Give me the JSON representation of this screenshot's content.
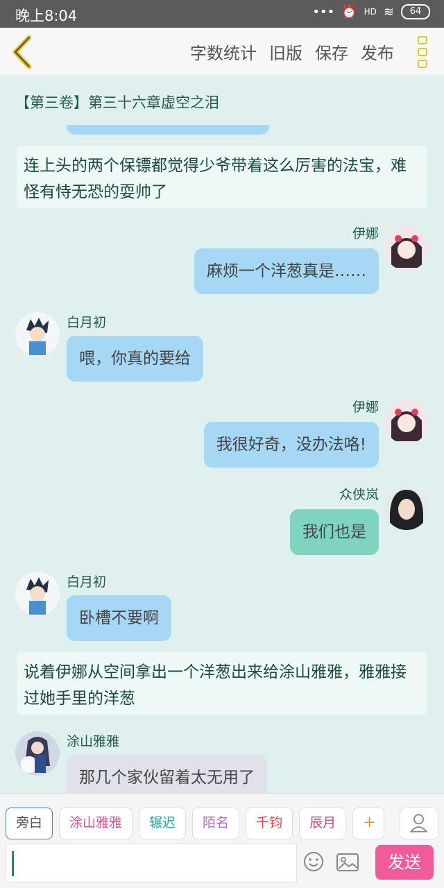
{
  "status": {
    "time": "晚上8:04",
    "signal_label": "HD",
    "battery": "64"
  },
  "topbar": {
    "actions": [
      "字数统计",
      "旧版",
      "保存",
      "发布"
    ]
  },
  "chapter_title": "【第三卷】第三十六章虚空之泪",
  "messages": [
    {
      "type": "narration",
      "text": "连上头的两个保镖都觉得少爷带着这么厉害的法宝，难怪有恃无恐的耍帅了"
    },
    {
      "type": "message",
      "side": "right",
      "name": "伊娜",
      "text": "麻烦一个洋葱真是……",
      "color": "#a6d7f5"
    },
    {
      "type": "message",
      "side": "left",
      "name": "白月初",
      "text": "喂，你真的要给",
      "color": "#a6d7f5"
    },
    {
      "type": "message",
      "side": "right",
      "name": "伊娜",
      "text": "我很好奇，没办法咯!",
      "color": "#a6d7f5"
    },
    {
      "type": "message",
      "side": "right",
      "name": "众侠岚",
      "text": "我们也是",
      "color": "#7fd4c1"
    },
    {
      "type": "message",
      "side": "left",
      "name": "白月初",
      "text": "卧槽不要啊",
      "color": "#a6d7f5"
    },
    {
      "type": "narration",
      "text": "说着伊娜从空间拿出一个洋葱出来给涂山雅雅，雅雅接过她手里的洋葱"
    },
    {
      "type": "message",
      "side": "left",
      "name": "涂山雅雅",
      "text": "那几个家伙留着太无用了",
      "color": "#dfe2ea"
    }
  ],
  "roles": [
    {
      "label": "旁白",
      "color": "#666666"
    },
    {
      "label": "涂山雅雅",
      "color": "#e0508a"
    },
    {
      "label": "辗迟",
      "color": "#2ea3a3"
    },
    {
      "label": "陌名",
      "color": "#b06cc8"
    },
    {
      "label": "千钧",
      "color": "#e04a4a"
    },
    {
      "label": "辰月",
      "color": "#d04a70"
    }
  ],
  "input": {
    "value": ""
  },
  "send_label": "发送"
}
